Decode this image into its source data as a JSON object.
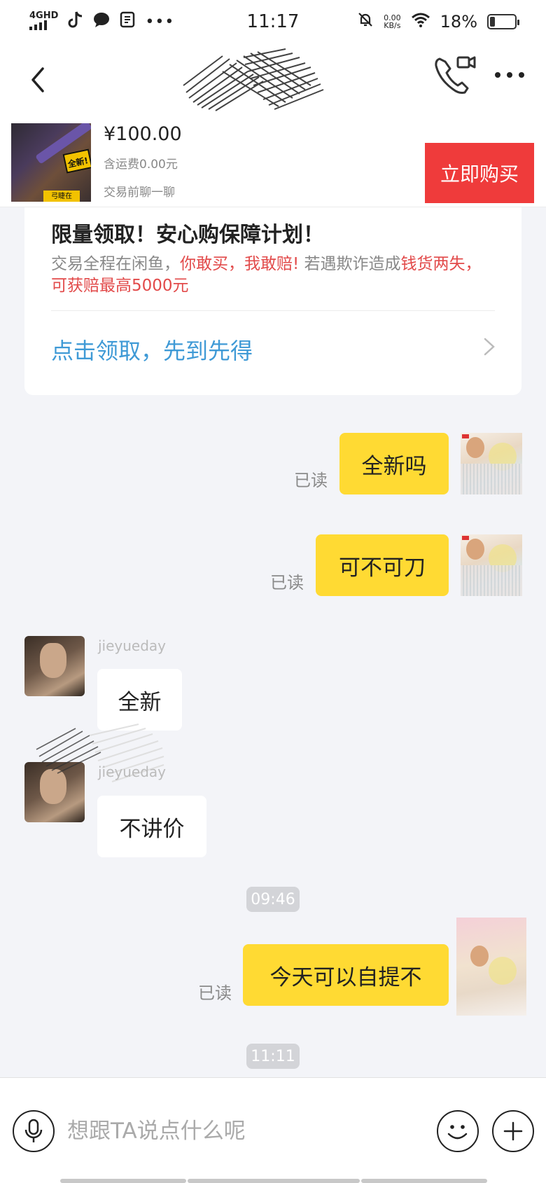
{
  "status_bar": {
    "network": "4GHD",
    "time": "11:17",
    "speed_value": "0.00",
    "speed_unit": "KB/s",
    "battery": "18%",
    "battery_level": 0.18,
    "left_icons": [
      "signal-icon",
      "tiktok-icon",
      "chat-bubble-icon",
      "app-icon",
      "more-dots-icon"
    ],
    "right_icons": [
      "mute-bell-icon",
      "wifi-icon",
      "battery-icon"
    ]
  },
  "nav": {
    "back_icon": "chevron-left-icon",
    "call_icon": "phone-video-icon",
    "more_icon": "more-horizontal-icon"
  },
  "product": {
    "price": "¥100.00",
    "shipping": "含运费0.00元",
    "chat_hint": "交易前聊一聊",
    "image_tag_1": "全新!",
    "image_tag_2": "弓睫在",
    "buy_label": "立即购买"
  },
  "promo": {
    "title": "限量领取！安心购保障计划！",
    "desc_part1": "交易全程在闲鱼，",
    "desc_part2": "你敢买，我敢赔!",
    "desc_part3": " 若遇欺诈造成",
    "desc_part4": "钱货两失，可获赔最高5000元",
    "link": "点击领取，先到先得"
  },
  "messages": {
    "m1": {
      "text": "全新吗",
      "read": "已读"
    },
    "m2": {
      "text": "可不可刀",
      "read": "已读"
    },
    "m3": {
      "text": "全新",
      "nick": "jieyueday"
    },
    "m4": {
      "text": "不讲价",
      "nick": "jieyueday"
    },
    "t1": "09:46",
    "m5": {
      "text": "今天可以自提不",
      "read": "已读"
    },
    "t2": "11:11"
  },
  "input": {
    "placeholder": "想跟TA说点什么呢"
  },
  "colors": {
    "accent_yellow": "#ffda33",
    "buy_red": "#ef3b3b",
    "link_blue": "#3f9ad6",
    "warn_red": "#e24a4a"
  }
}
